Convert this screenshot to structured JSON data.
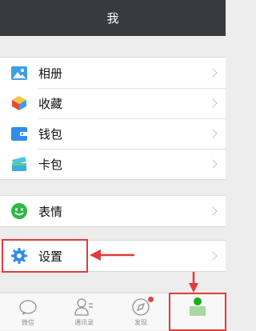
{
  "header": {
    "title": "我"
  },
  "group1": [
    {
      "label": "相册",
      "icon": "album-icon"
    },
    {
      "label": "收藏",
      "icon": "favorites-icon"
    },
    {
      "label": "钱包",
      "icon": "wallet-icon"
    },
    {
      "label": "卡包",
      "icon": "card-package-icon"
    }
  ],
  "group2": [
    {
      "label": "表情",
      "icon": "sticker-icon"
    }
  ],
  "group3": [
    {
      "label": "设置",
      "icon": "settings-gear-icon"
    }
  ],
  "tabbar": [
    {
      "label": "微信",
      "icon": "chat-bubble-icon"
    },
    {
      "label": "通讯录",
      "icon": "contacts-icon"
    },
    {
      "label": "发现",
      "icon": "discover-icon"
    },
    {
      "label": "",
      "icon": "me-person-icon"
    }
  ],
  "colors": {
    "header_bg": "#393a3f",
    "accent_green": "#1aad19",
    "annotation_red": "#e23b3b"
  }
}
